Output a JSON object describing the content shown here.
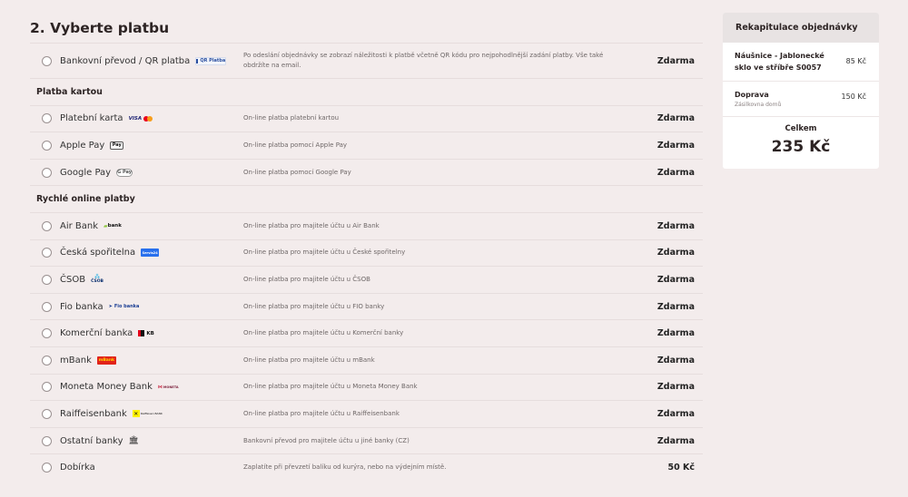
{
  "heading": "2. Vyberte platbu",
  "qr_row": {
    "name": "Bankovní převod / QR platba",
    "logo": "QR Platba",
    "desc": "Po odeslání objednávky se zobrazí náležitosti k platbě včetně QR kódu pro nejpohodlnější zadání platby. Vše také obdržíte na email.",
    "price": "Zdarma"
  },
  "card_section": {
    "title": "Platba kartou",
    "items": [
      {
        "name": "Platební karta",
        "logo": "VISA",
        "desc": "On-line platba platební kartou",
        "price": "Zdarma"
      },
      {
        "name": "Apple Pay",
        "logo": "Pay",
        "desc": "On-line platba pomocí Apple Pay",
        "price": "Zdarma"
      },
      {
        "name": "Google Pay",
        "logo": "G Pay",
        "desc": "On-line platba pomocí Google Pay",
        "price": "Zdarma"
      }
    ]
  },
  "quick_section": {
    "title": "Rychlé online platby",
    "items": [
      {
        "name": "Air Bank",
        "logo": "bank",
        "desc": "On-line platba pro majitele účtu u Air Bank",
        "price": "Zdarma"
      },
      {
        "name": "Česká spořitelna",
        "logo": "Servis24",
        "desc": "On-line platba pro majitele účtu u České spořitelny",
        "price": "Zdarma"
      },
      {
        "name": "ČSOB",
        "logo": "ČSOB",
        "desc": "On-line platba pro majitele účtu u ČSOB",
        "price": "Zdarma"
      },
      {
        "name": "Fio banka",
        "logo": "Fio banka",
        "desc": "On-line platba pro majitele účtu u FIO banky",
        "price": "Zdarma"
      },
      {
        "name": "Komerční banka",
        "logo": "KB",
        "desc": "On-line platba pro majitele účtu u Komerční banky",
        "price": "Zdarma"
      },
      {
        "name": "mBank",
        "logo": "mBank",
        "desc": "On-line platba pro majitele účtu u mBank",
        "price": "Zdarma"
      },
      {
        "name": "Moneta Money Bank",
        "logo": "MONETA",
        "desc": "On-line platba pro majitele účtu u Moneta Money Bank",
        "price": "Zdarma"
      },
      {
        "name": "Raiffeisenbank",
        "logo": "Raiffeisen BANK",
        "desc": "On-line platba pro majitele účtu u Raiffeisenbank",
        "price": "Zdarma"
      },
      {
        "name": "Ostatní banky",
        "logo": "bank-building",
        "desc": "Bankovní převod pro majitele účtu u jiné banky (CZ)",
        "price": "Zdarma"
      }
    ]
  },
  "cod_row": {
    "name": "Dobírka",
    "desc": "Zaplatíte při převzetí balíku od kurýra, nebo na výdejním místě.",
    "price": "50 Kč"
  },
  "summary": {
    "title": "Rekapitulace objednávky",
    "product": {
      "name": "Náušnice - Jablonecké sklo ve stříbře S0057",
      "price": "85 Kč"
    },
    "shipping": {
      "name": "Doprava",
      "sub": "Zásilkovna domů",
      "price": "150 Kč"
    },
    "total_label": "Celkem",
    "total_value": "235 Kč"
  },
  "colors": {
    "background": "#f3ecec",
    "accent_dark": "#2d2424",
    "divider": "#e6dddd"
  }
}
